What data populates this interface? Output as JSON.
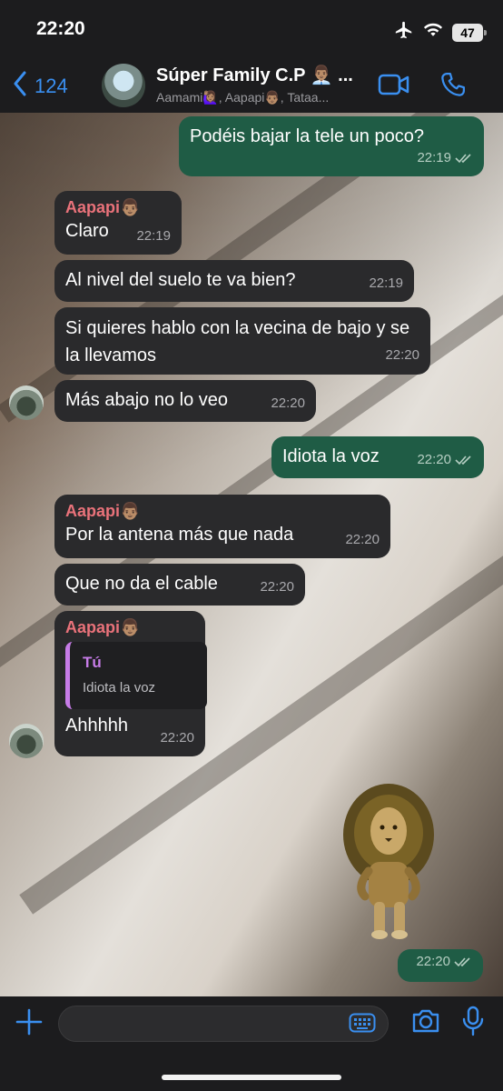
{
  "status_bar": {
    "time": "22:20",
    "battery": "47",
    "icons": [
      "airplane-icon",
      "wifi-icon",
      "battery-icon"
    ]
  },
  "header": {
    "back_count": "124",
    "title": "Súper Family C.P 👨🏽‍💼 ...",
    "subtitle": "Aamami🙋🏽‍♀️, Aapapi👨🏽, Tataa...",
    "icons": [
      "chevron-left-icon",
      "video-call-icon",
      "phone-icon"
    ],
    "accent_color": "#3a8ff0"
  },
  "messages": [
    {
      "direction": "out",
      "text": "Podéis bajar la tele un poco?",
      "time": "22:19"
    },
    {
      "direction": "in",
      "sender": "Aapapi👨🏽",
      "text": "Claro",
      "time": "22:19"
    },
    {
      "direction": "in",
      "text": "Al nivel del suelo te va bien?",
      "time": "22:19"
    },
    {
      "direction": "in",
      "text": "Si quieres hablo con la vecina de bajo y se la llevamos",
      "time": "22:20"
    },
    {
      "direction": "in",
      "text": "Más abajo no lo veo",
      "time": "22:20"
    },
    {
      "direction": "out",
      "text": "Idiota la voz",
      "time": "22:20"
    },
    {
      "direction": "in",
      "sender": "Aapapi👨🏽",
      "text": "Por la antena más que nada",
      "time": "22:20"
    },
    {
      "direction": "in",
      "text": "Que no da el cable",
      "time": "22:20"
    },
    {
      "direction": "in",
      "sender": "Aapapi👨🏽",
      "quote_author": "Tú",
      "quote_text": "Idiota la voz",
      "text": "Ahhhhh",
      "time": "22:20"
    },
    {
      "direction": "out",
      "sticker": "lion-sticker",
      "time": "22:20"
    }
  ],
  "colors": {
    "incoming_bubble": "#2a2a2c",
    "outgoing_bubble": "#1f5c45",
    "sender_name": "#e9727a",
    "quote_accent": "#c77ce8"
  },
  "input_bar": {
    "placeholder": "",
    "icons": [
      "plus-icon",
      "keyboard-icon",
      "camera-icon",
      "microphone-icon"
    ]
  }
}
